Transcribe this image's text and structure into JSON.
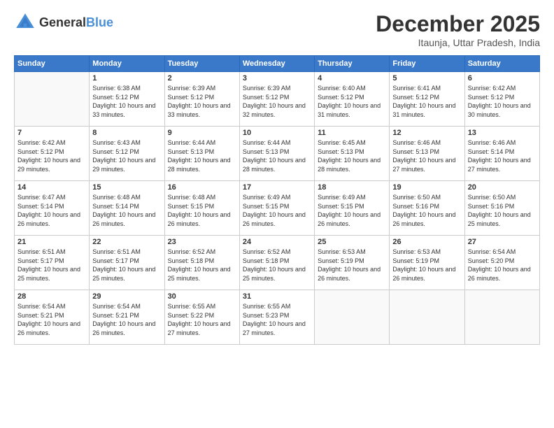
{
  "header": {
    "logo_general": "General",
    "logo_blue": "Blue",
    "month_title": "December 2025",
    "location": "Itaunja, Uttar Pradesh, India"
  },
  "weekdays": [
    "Sunday",
    "Monday",
    "Tuesday",
    "Wednesday",
    "Thursday",
    "Friday",
    "Saturday"
  ],
  "weeks": [
    [
      {
        "day": "",
        "sunrise": "",
        "sunset": "",
        "daylight": ""
      },
      {
        "day": "1",
        "sunrise": "Sunrise: 6:38 AM",
        "sunset": "Sunset: 5:12 PM",
        "daylight": "Daylight: 10 hours and 33 minutes."
      },
      {
        "day": "2",
        "sunrise": "Sunrise: 6:39 AM",
        "sunset": "Sunset: 5:12 PM",
        "daylight": "Daylight: 10 hours and 33 minutes."
      },
      {
        "day": "3",
        "sunrise": "Sunrise: 6:39 AM",
        "sunset": "Sunset: 5:12 PM",
        "daylight": "Daylight: 10 hours and 32 minutes."
      },
      {
        "day": "4",
        "sunrise": "Sunrise: 6:40 AM",
        "sunset": "Sunset: 5:12 PM",
        "daylight": "Daylight: 10 hours and 31 minutes."
      },
      {
        "day": "5",
        "sunrise": "Sunrise: 6:41 AM",
        "sunset": "Sunset: 5:12 PM",
        "daylight": "Daylight: 10 hours and 31 minutes."
      },
      {
        "day": "6",
        "sunrise": "Sunrise: 6:42 AM",
        "sunset": "Sunset: 5:12 PM",
        "daylight": "Daylight: 10 hours and 30 minutes."
      }
    ],
    [
      {
        "day": "7",
        "sunrise": "Sunrise: 6:42 AM",
        "sunset": "Sunset: 5:12 PM",
        "daylight": "Daylight: 10 hours and 29 minutes."
      },
      {
        "day": "8",
        "sunrise": "Sunrise: 6:43 AM",
        "sunset": "Sunset: 5:12 PM",
        "daylight": "Daylight: 10 hours and 29 minutes."
      },
      {
        "day": "9",
        "sunrise": "Sunrise: 6:44 AM",
        "sunset": "Sunset: 5:13 PM",
        "daylight": "Daylight: 10 hours and 28 minutes."
      },
      {
        "day": "10",
        "sunrise": "Sunrise: 6:44 AM",
        "sunset": "Sunset: 5:13 PM",
        "daylight": "Daylight: 10 hours and 28 minutes."
      },
      {
        "day": "11",
        "sunrise": "Sunrise: 6:45 AM",
        "sunset": "Sunset: 5:13 PM",
        "daylight": "Daylight: 10 hours and 28 minutes."
      },
      {
        "day": "12",
        "sunrise": "Sunrise: 6:46 AM",
        "sunset": "Sunset: 5:13 PM",
        "daylight": "Daylight: 10 hours and 27 minutes."
      },
      {
        "day": "13",
        "sunrise": "Sunrise: 6:46 AM",
        "sunset": "Sunset: 5:14 PM",
        "daylight": "Daylight: 10 hours and 27 minutes."
      }
    ],
    [
      {
        "day": "14",
        "sunrise": "Sunrise: 6:47 AM",
        "sunset": "Sunset: 5:14 PM",
        "daylight": "Daylight: 10 hours and 26 minutes."
      },
      {
        "day": "15",
        "sunrise": "Sunrise: 6:48 AM",
        "sunset": "Sunset: 5:14 PM",
        "daylight": "Daylight: 10 hours and 26 minutes."
      },
      {
        "day": "16",
        "sunrise": "Sunrise: 6:48 AM",
        "sunset": "Sunset: 5:15 PM",
        "daylight": "Daylight: 10 hours and 26 minutes."
      },
      {
        "day": "17",
        "sunrise": "Sunrise: 6:49 AM",
        "sunset": "Sunset: 5:15 PM",
        "daylight": "Daylight: 10 hours and 26 minutes."
      },
      {
        "day": "18",
        "sunrise": "Sunrise: 6:49 AM",
        "sunset": "Sunset: 5:15 PM",
        "daylight": "Daylight: 10 hours and 26 minutes."
      },
      {
        "day": "19",
        "sunrise": "Sunrise: 6:50 AM",
        "sunset": "Sunset: 5:16 PM",
        "daylight": "Daylight: 10 hours and 26 minutes."
      },
      {
        "day": "20",
        "sunrise": "Sunrise: 6:50 AM",
        "sunset": "Sunset: 5:16 PM",
        "daylight": "Daylight: 10 hours and 25 minutes."
      }
    ],
    [
      {
        "day": "21",
        "sunrise": "Sunrise: 6:51 AM",
        "sunset": "Sunset: 5:17 PM",
        "daylight": "Daylight: 10 hours and 25 minutes."
      },
      {
        "day": "22",
        "sunrise": "Sunrise: 6:51 AM",
        "sunset": "Sunset: 5:17 PM",
        "daylight": "Daylight: 10 hours and 25 minutes."
      },
      {
        "day": "23",
        "sunrise": "Sunrise: 6:52 AM",
        "sunset": "Sunset: 5:18 PM",
        "daylight": "Daylight: 10 hours and 25 minutes."
      },
      {
        "day": "24",
        "sunrise": "Sunrise: 6:52 AM",
        "sunset": "Sunset: 5:18 PM",
        "daylight": "Daylight: 10 hours and 25 minutes."
      },
      {
        "day": "25",
        "sunrise": "Sunrise: 6:53 AM",
        "sunset": "Sunset: 5:19 PM",
        "daylight": "Daylight: 10 hours and 26 minutes."
      },
      {
        "day": "26",
        "sunrise": "Sunrise: 6:53 AM",
        "sunset": "Sunset: 5:19 PM",
        "daylight": "Daylight: 10 hours and 26 minutes."
      },
      {
        "day": "27",
        "sunrise": "Sunrise: 6:54 AM",
        "sunset": "Sunset: 5:20 PM",
        "daylight": "Daylight: 10 hours and 26 minutes."
      }
    ],
    [
      {
        "day": "28",
        "sunrise": "Sunrise: 6:54 AM",
        "sunset": "Sunset: 5:21 PM",
        "daylight": "Daylight: 10 hours and 26 minutes."
      },
      {
        "day": "29",
        "sunrise": "Sunrise: 6:54 AM",
        "sunset": "Sunset: 5:21 PM",
        "daylight": "Daylight: 10 hours and 26 minutes."
      },
      {
        "day": "30",
        "sunrise": "Sunrise: 6:55 AM",
        "sunset": "Sunset: 5:22 PM",
        "daylight": "Daylight: 10 hours and 27 minutes."
      },
      {
        "day": "31",
        "sunrise": "Sunrise: 6:55 AM",
        "sunset": "Sunset: 5:23 PM",
        "daylight": "Daylight: 10 hours and 27 minutes."
      },
      {
        "day": "",
        "sunrise": "",
        "sunset": "",
        "daylight": ""
      },
      {
        "day": "",
        "sunrise": "",
        "sunset": "",
        "daylight": ""
      },
      {
        "day": "",
        "sunrise": "",
        "sunset": "",
        "daylight": ""
      }
    ]
  ]
}
